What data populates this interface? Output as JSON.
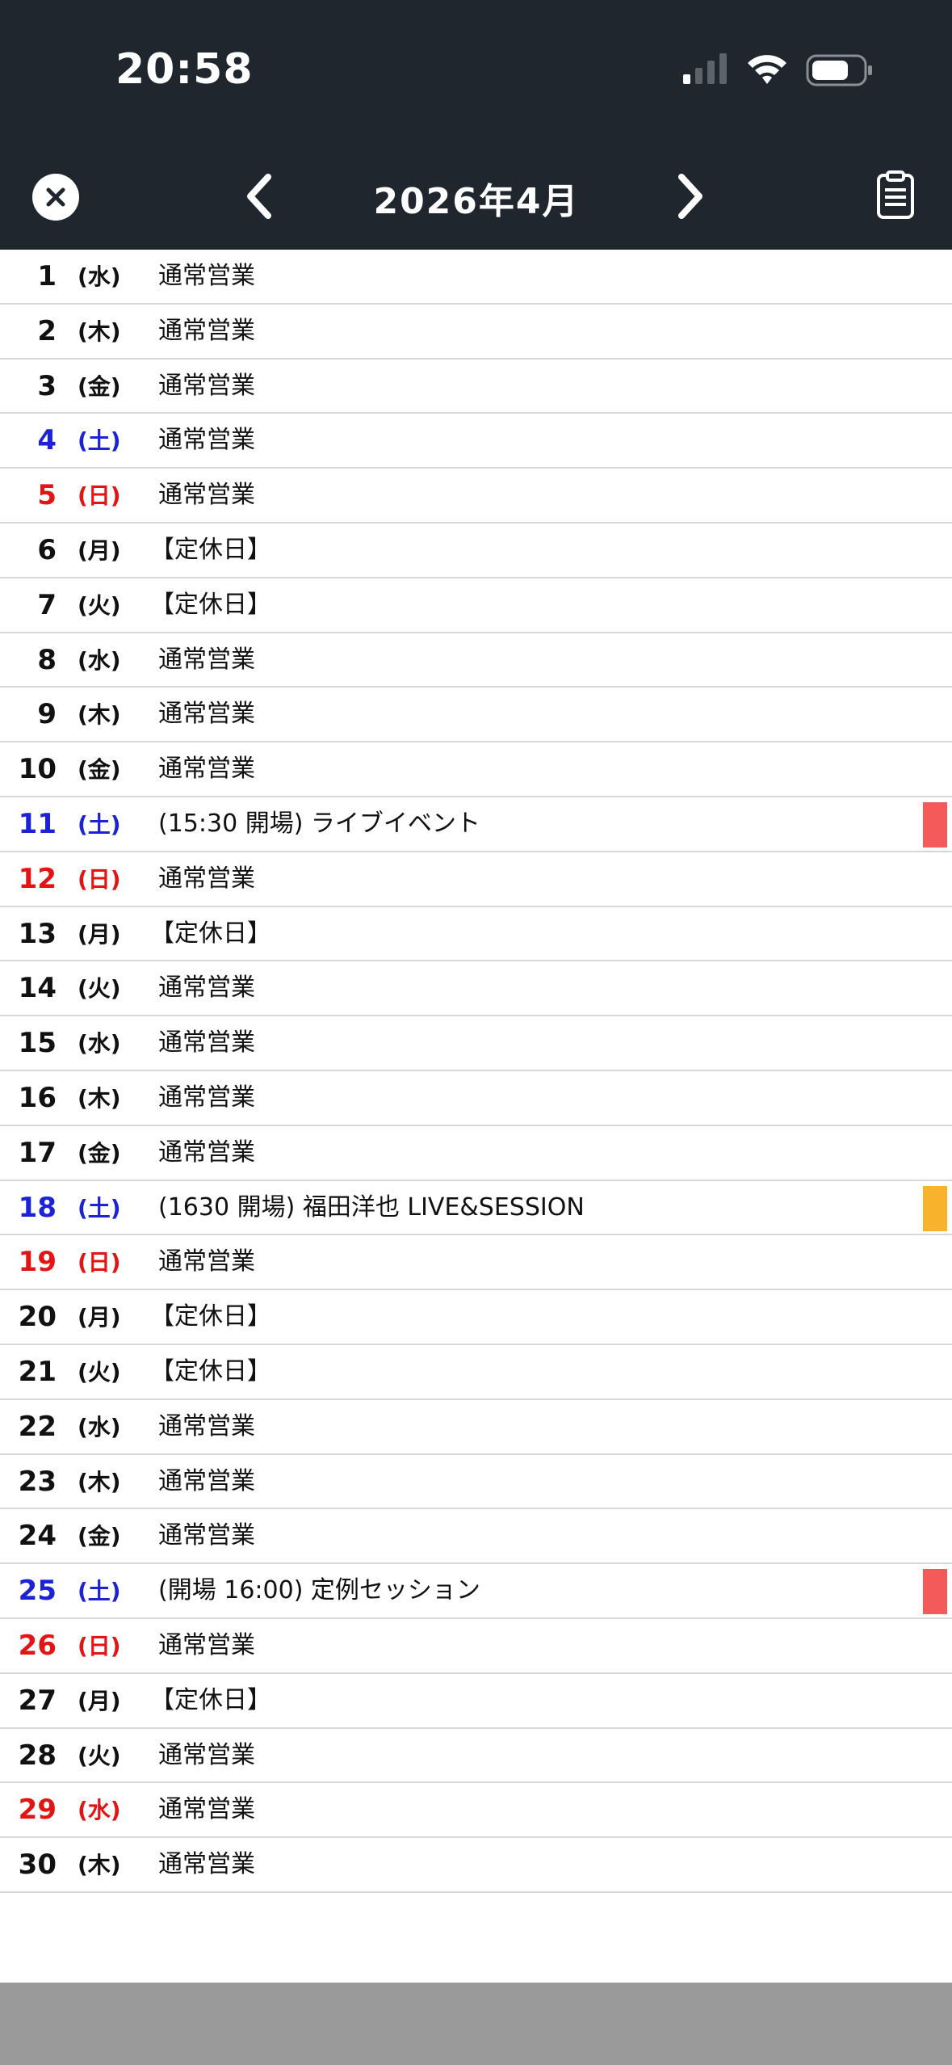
{
  "status": {
    "time": "20:58"
  },
  "nav": {
    "title": "2026年4月"
  },
  "colors": {
    "saturday": "#1e22d6",
    "sunday": "#e31414",
    "event_red": "#f45a5a",
    "event_orange": "#f8b22c",
    "header_bg": "#20262e"
  },
  "days": [
    {
      "day": "1",
      "weekday": "(水)",
      "text": "通常営業",
      "type": "weekday"
    },
    {
      "day": "2",
      "weekday": "(木)",
      "text": "通常営業",
      "type": "weekday"
    },
    {
      "day": "3",
      "weekday": "(金)",
      "text": "通常営業",
      "type": "weekday"
    },
    {
      "day": "4",
      "weekday": "(土)",
      "text": "通常営業",
      "type": "sat"
    },
    {
      "day": "5",
      "weekday": "(日)",
      "text": "通常営業",
      "type": "sun"
    },
    {
      "day": "6",
      "weekday": "(月)",
      "text": "【定休日】",
      "type": "weekday"
    },
    {
      "day": "7",
      "weekday": "(火)",
      "text": "【定休日】",
      "type": "weekday"
    },
    {
      "day": "8",
      "weekday": "(水)",
      "text": "通常営業",
      "type": "weekday"
    },
    {
      "day": "9",
      "weekday": "(木)",
      "text": "通常営業",
      "type": "weekday"
    },
    {
      "day": "10",
      "weekday": "(金)",
      "text": "通常営業",
      "type": "weekday"
    },
    {
      "day": "11",
      "weekday": "(土)",
      "text": "(15:30 開場) ライブイベント",
      "type": "sat",
      "marker": "#f45a5a"
    },
    {
      "day": "12",
      "weekday": "(日)",
      "text": "通常営業",
      "type": "sun"
    },
    {
      "day": "13",
      "weekday": "(月)",
      "text": "【定休日】",
      "type": "weekday"
    },
    {
      "day": "14",
      "weekday": "(火)",
      "text": "通常営業",
      "type": "weekday"
    },
    {
      "day": "15",
      "weekday": "(水)",
      "text": "通常営業",
      "type": "weekday"
    },
    {
      "day": "16",
      "weekday": "(木)",
      "text": "通常営業",
      "type": "weekday"
    },
    {
      "day": "17",
      "weekday": "(金)",
      "text": "通常営業",
      "type": "weekday"
    },
    {
      "day": "18",
      "weekday": "(土)",
      "text": "(1630 開場) 福田洋也 LIVE&SESSION",
      "type": "sat",
      "marker": "#f8b22c"
    },
    {
      "day": "19",
      "weekday": "(日)",
      "text": "通常営業",
      "type": "sun"
    },
    {
      "day": "20",
      "weekday": "(月)",
      "text": "【定休日】",
      "type": "weekday"
    },
    {
      "day": "21",
      "weekday": "(火)",
      "text": "【定休日】",
      "type": "weekday"
    },
    {
      "day": "22",
      "weekday": "(水)",
      "text": "通常営業",
      "type": "weekday"
    },
    {
      "day": "23",
      "weekday": "(木)",
      "text": "通常営業",
      "type": "weekday"
    },
    {
      "day": "24",
      "weekday": "(金)",
      "text": "通常営業",
      "type": "weekday"
    },
    {
      "day": "25",
      "weekday": "(土)",
      "text": "(開場 16:00) 定例セッション",
      "type": "sat",
      "marker": "#f45a5a"
    },
    {
      "day": "26",
      "weekday": "(日)",
      "text": "通常営業",
      "type": "sun"
    },
    {
      "day": "27",
      "weekday": "(月)",
      "text": "【定休日】",
      "type": "weekday"
    },
    {
      "day": "28",
      "weekday": "(火)",
      "text": "通常営業",
      "type": "weekday"
    },
    {
      "day": "29",
      "weekday": "(水)",
      "text": "通常営業",
      "type": "sun"
    },
    {
      "day": "30",
      "weekday": "(木)",
      "text": "通常営業",
      "type": "weekday"
    }
  ]
}
